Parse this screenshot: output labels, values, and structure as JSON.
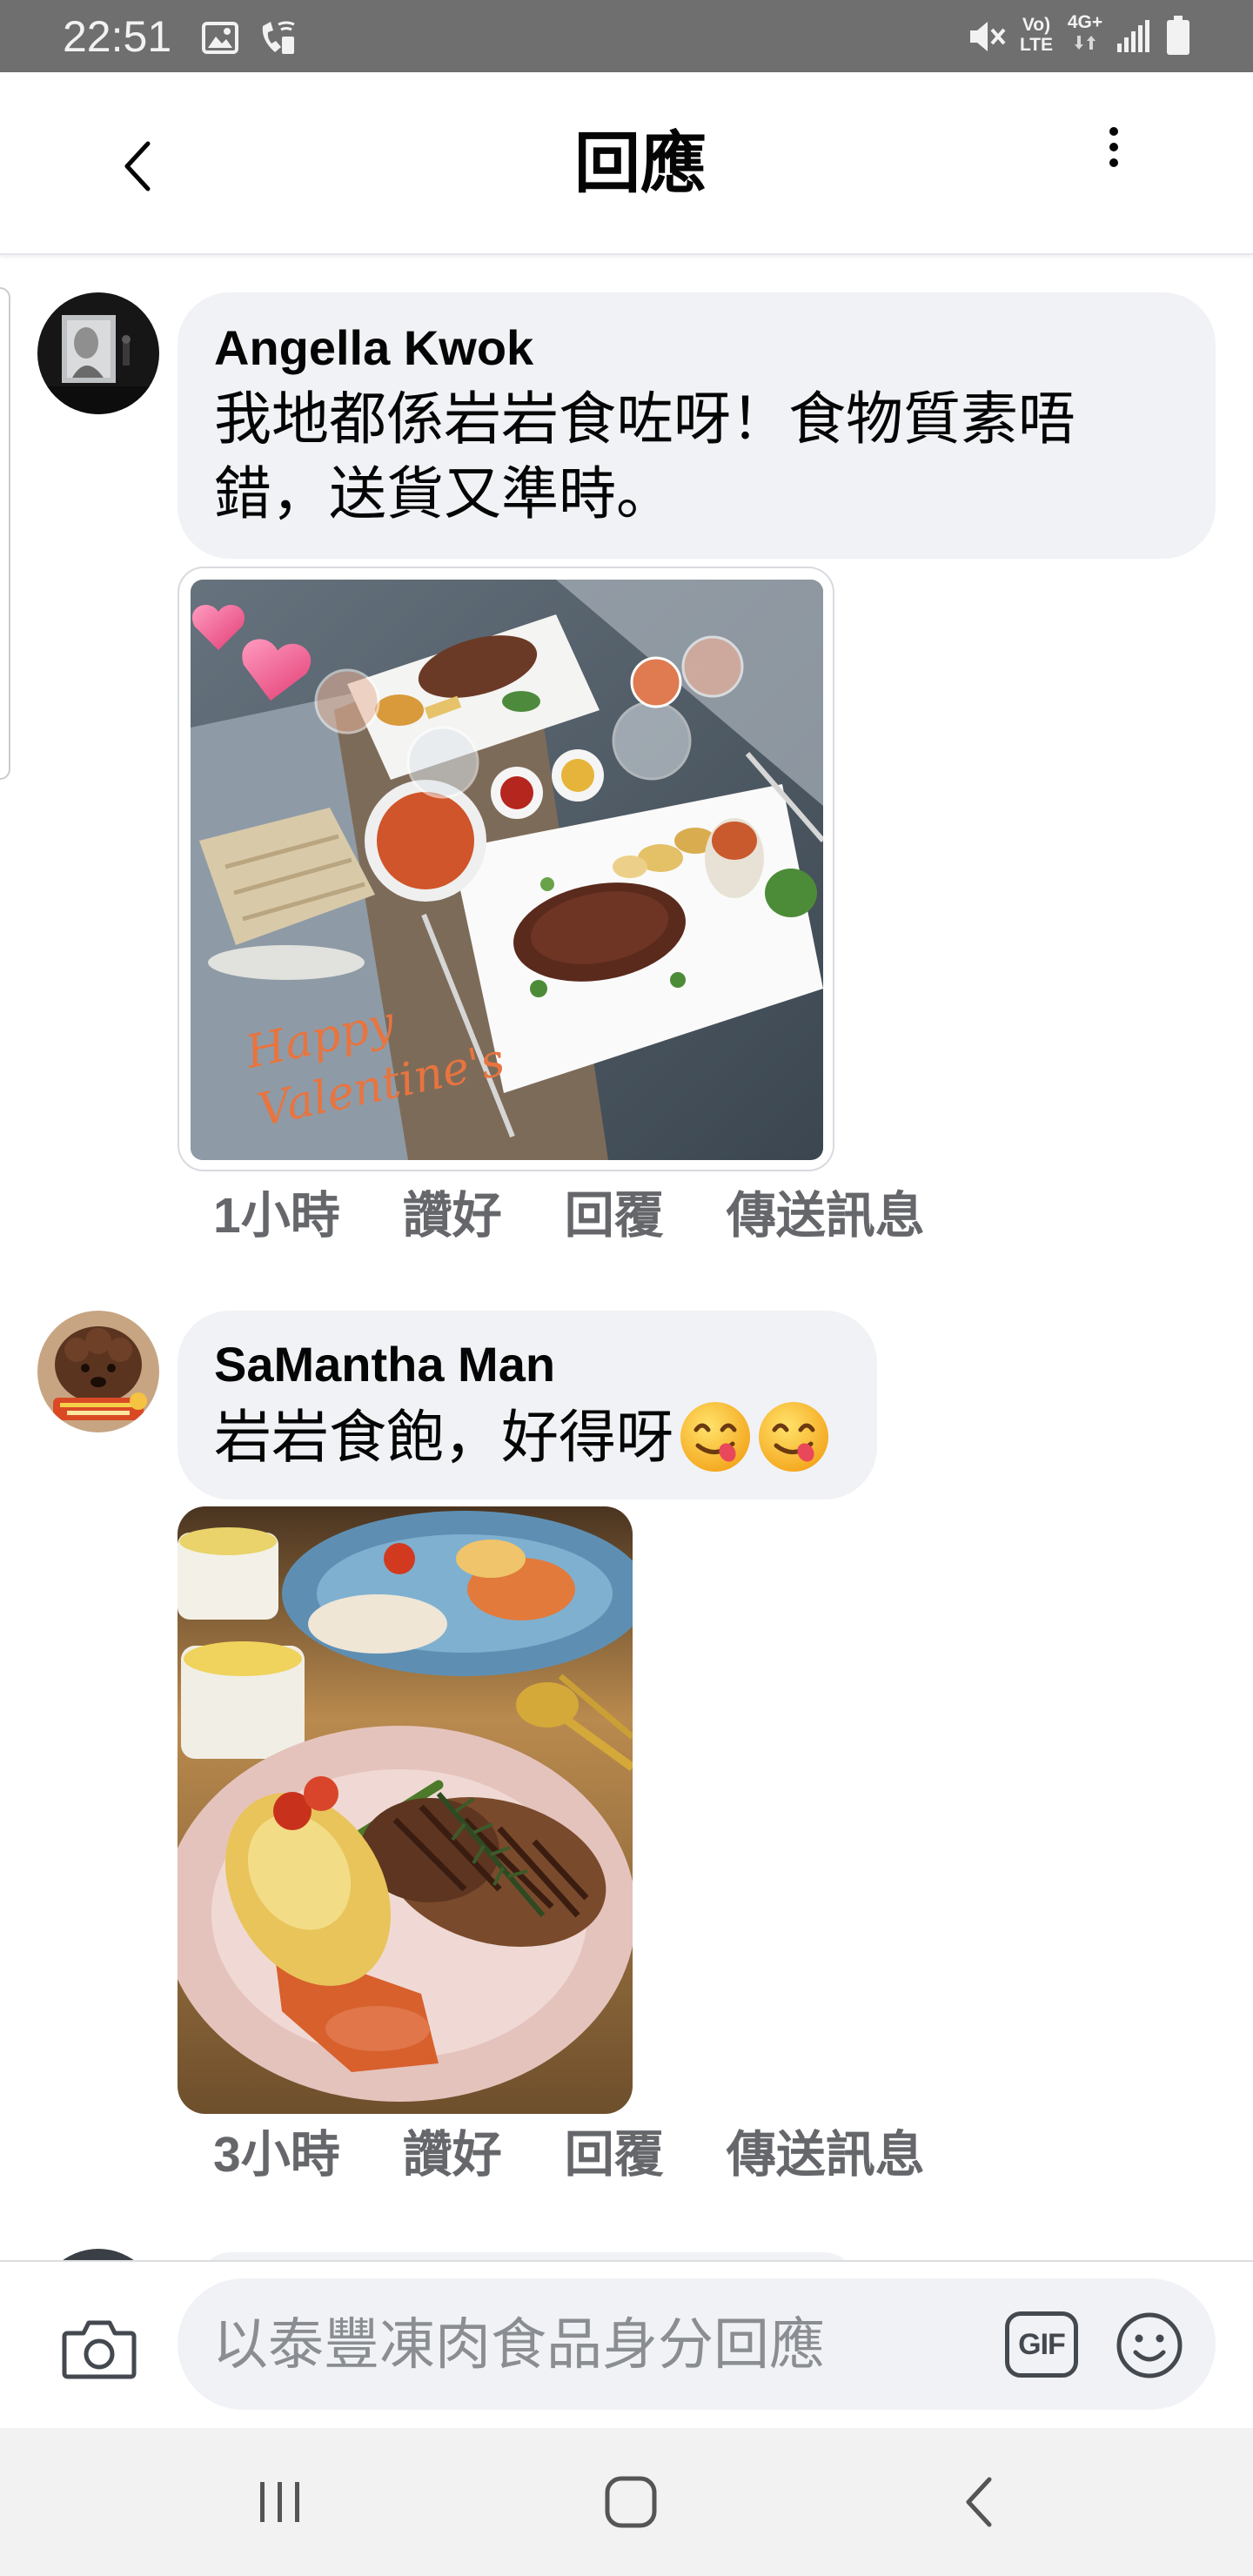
{
  "status_bar": {
    "time": "22:51",
    "volte_top": "Vo)",
    "volte_bottom": "LTE",
    "network": "4G+",
    "icons": [
      "gallery-icon",
      "wifi-call-icon",
      "mute-icon",
      "signal-icon",
      "battery-icon"
    ],
    "background": "#6f6f6f"
  },
  "header": {
    "title": "回應",
    "back_icon": "chevron-left-icon",
    "more_icon": "more-vertical-icon"
  },
  "comments": [
    {
      "author": "Angella Kwok",
      "text_lines": [
        "我地都係岩岩食咗呀！食物質素唔",
        "錯，送貨又準時。"
      ],
      "photo_caption_lines": [
        "Happy",
        "Valentine's"
      ],
      "time": "1小時",
      "actions": [
        "讚好",
        "回覆",
        "傳送訊息"
      ]
    },
    {
      "author": "SaMantha Man",
      "text": "岩岩食飽，好得呀",
      "emoji_icons": [
        "face-savoring-food-icon",
        "face-savoring-food-icon"
      ],
      "time": "3小時",
      "actions": [
        "讚好",
        "回覆",
        "傳送訊息"
      ]
    }
  ],
  "composer": {
    "placeholder": "以泰豐凍肉食品身分回應",
    "gif_label": "GIF",
    "camera_icon": "camera-icon",
    "emoji_icon": "smiley-icon"
  },
  "nav_bar": {
    "icons": [
      "recent-apps-icon",
      "home-icon",
      "back-icon"
    ]
  },
  "colors": {
    "bubble": "#f0f2f5",
    "meta_text": "#65676b",
    "primary_text": "#050505",
    "nav_bar": "#f2f2f2"
  }
}
